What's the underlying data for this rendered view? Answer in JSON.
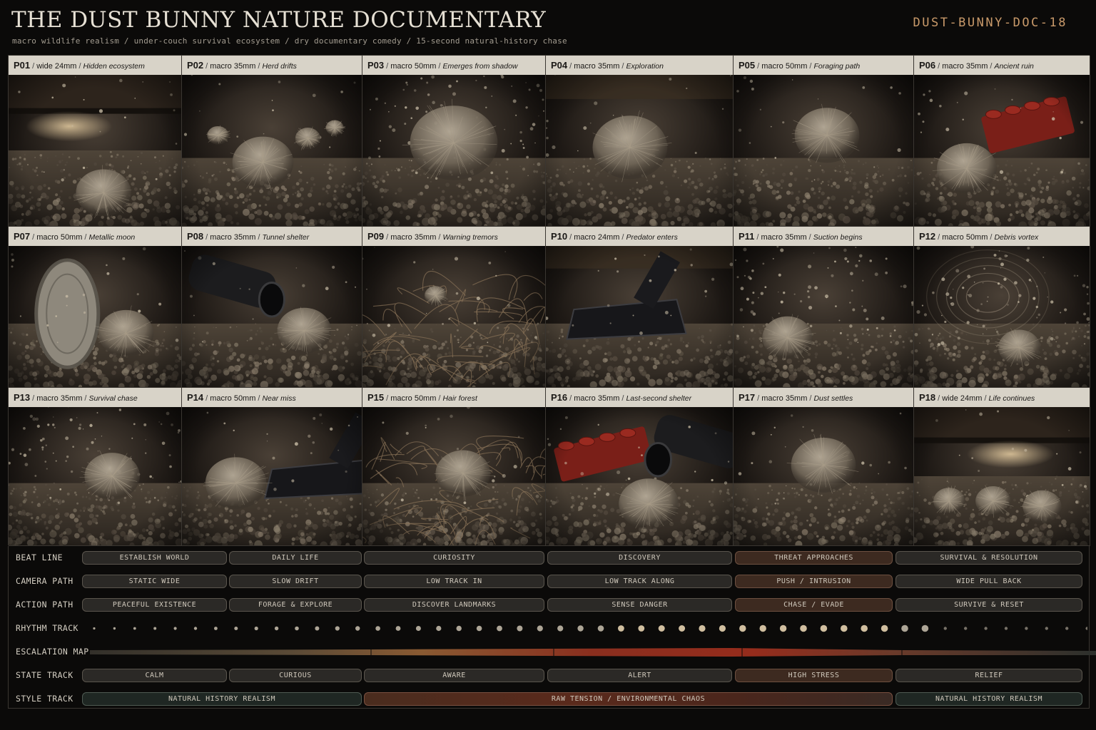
{
  "header": {
    "title": "THE DUST BUNNY NATURE DOCUMENTARY",
    "subtitle": "macro wildlife realism / under-couch survival ecosystem / dry documentary comedy / 15-second natural-history chase",
    "code": "DUST-BUNNY-DOC-18"
  },
  "panels": [
    {
      "id": "P01",
      "lens": "wide 24mm",
      "name": "Hidden ecosystem",
      "scene": "couch"
    },
    {
      "id": "P02",
      "lens": "macro 35mm",
      "name": "Herd drifts",
      "scene": "herd"
    },
    {
      "id": "P03",
      "lens": "macro 50mm",
      "name": "Emerges from shadow",
      "scene": "emerge"
    },
    {
      "id": "P04",
      "lens": "macro 35mm",
      "name": "Exploration",
      "scene": "explore"
    },
    {
      "id": "P05",
      "lens": "macro 50mm",
      "name": "Foraging path",
      "scene": "forage"
    },
    {
      "id": "P06",
      "lens": "macro 35mm",
      "name": "Ancient ruin",
      "scene": "lego"
    },
    {
      "id": "P07",
      "lens": "macro 50mm",
      "name": "Metallic moon",
      "scene": "coin"
    },
    {
      "id": "P08",
      "lens": "macro 35mm",
      "name": "Tunnel shelter",
      "scene": "tube"
    },
    {
      "id": "P09",
      "lens": "macro 35mm",
      "name": "Warning tremors",
      "scene": "tremor"
    },
    {
      "id": "P10",
      "lens": "macro 24mm",
      "name": "Predator enters",
      "scene": "vacuum"
    },
    {
      "id": "P11",
      "lens": "macro 35mm",
      "name": "Suction begins",
      "scene": "suction"
    },
    {
      "id": "P12",
      "lens": "macro 50mm",
      "name": "Debris vortex",
      "scene": "vortex"
    },
    {
      "id": "P13",
      "lens": "macro 35mm",
      "name": "Survival chase",
      "scene": "chase"
    },
    {
      "id": "P14",
      "lens": "macro 50mm",
      "name": "Near miss",
      "scene": "nearmiss"
    },
    {
      "id": "P15",
      "lens": "macro 50mm",
      "name": "Hair forest",
      "scene": "hair"
    },
    {
      "id": "P16",
      "lens": "macro 35mm",
      "name": "Last-second shelter",
      "scene": "shelter"
    },
    {
      "id": "P17",
      "lens": "macro 35mm",
      "name": "Dust settles",
      "scene": "settle"
    },
    {
      "id": "P18",
      "lens": "wide 24mm",
      "name": "Life continues",
      "scene": "couch2"
    }
  ],
  "tracks": {
    "beat": {
      "label": "BEAT  LINE",
      "items": [
        "ESTABLISH WORLD",
        "DAILY LIFE",
        "CURIOSITY",
        "DISCOVERY",
        "THREAT APPROACHES",
        "SURVIVAL & RESOLUTION"
      ]
    },
    "camera": {
      "label": "CAMERA PATH",
      "items": [
        "STATIC WIDE",
        "SLOW DRIFT",
        "LOW TRACK IN",
        "LOW TRACK ALONG",
        "PUSH / INTRUSION",
        "WIDE PULL BACK"
      ]
    },
    "action": {
      "label": "ACTION PATH",
      "items": [
        "PEACEFUL EXISTENCE",
        "FORAGE & EXPLORE",
        "DISCOVER LANDMARKS",
        "SENSE DANGER",
        "CHASE / EVADE",
        "SURVIVE & RESET"
      ]
    },
    "rhythm": {
      "label": "RHYTHM TRACK"
    },
    "escalation": {
      "label": "ESCALATION MAP"
    },
    "state": {
      "label": "STATE TRACK",
      "items": [
        "CALM",
        "CURIOUS",
        "AWARE",
        "ALERT",
        "HIGH STRESS",
        "RELIEF"
      ]
    },
    "style": {
      "label": "STYLE TRACK",
      "items": [
        "NATURAL HISTORY REALISM",
        "RAW TENSION / ENVIRONMENTAL CHAOS",
        "NATURAL HISTORY REALISM"
      ]
    }
  },
  "colors": {
    "accent": "#c99a6a",
    "label_bg": "#d8d3c8",
    "escalation_hot": "#8e2a1c"
  }
}
